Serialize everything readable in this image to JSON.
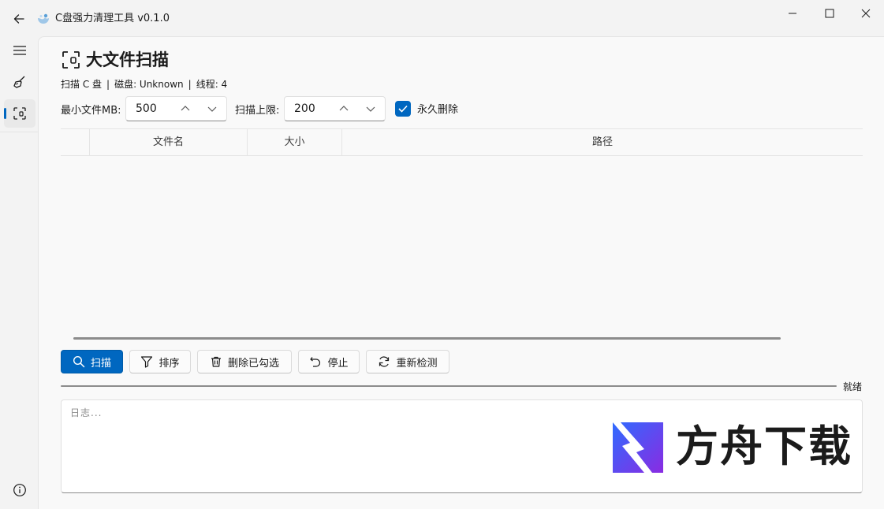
{
  "window": {
    "title": "C盘强力清理工具 v0.1.0"
  },
  "nav": {
    "items": [
      {
        "icon": "hamburger-icon"
      },
      {
        "icon": "broom-icon"
      },
      {
        "icon": "scan-frame-icon",
        "active": true
      }
    ],
    "footer_icon": "info-icon"
  },
  "page": {
    "title": "大文件扫描",
    "info": {
      "scan": "扫描 C 盘",
      "sep": "|",
      "disk": "磁盘: Unknown",
      "threads": "线程: 4"
    },
    "controls": {
      "min_size_label": "最小文件MB:",
      "min_size_value": "500",
      "limit_label": "扫描上限:",
      "limit_value": "200",
      "permanent_delete_label": "永久删除",
      "permanent_delete_checked": true
    },
    "table": {
      "columns": [
        "文件名",
        "大小",
        "路径"
      ],
      "rows": []
    },
    "buttons": {
      "scan": "扫描",
      "sort": "排序",
      "delete_checked": "删除已勾选",
      "stop": "停止",
      "recheck": "重新检测"
    },
    "status": "就绪",
    "log_placeholder": "日志..."
  },
  "watermark": {
    "text": "方舟下载"
  },
  "colors": {
    "accent": "#0067c0",
    "background": "#f3f3f3",
    "content": "#f9f9f9"
  }
}
